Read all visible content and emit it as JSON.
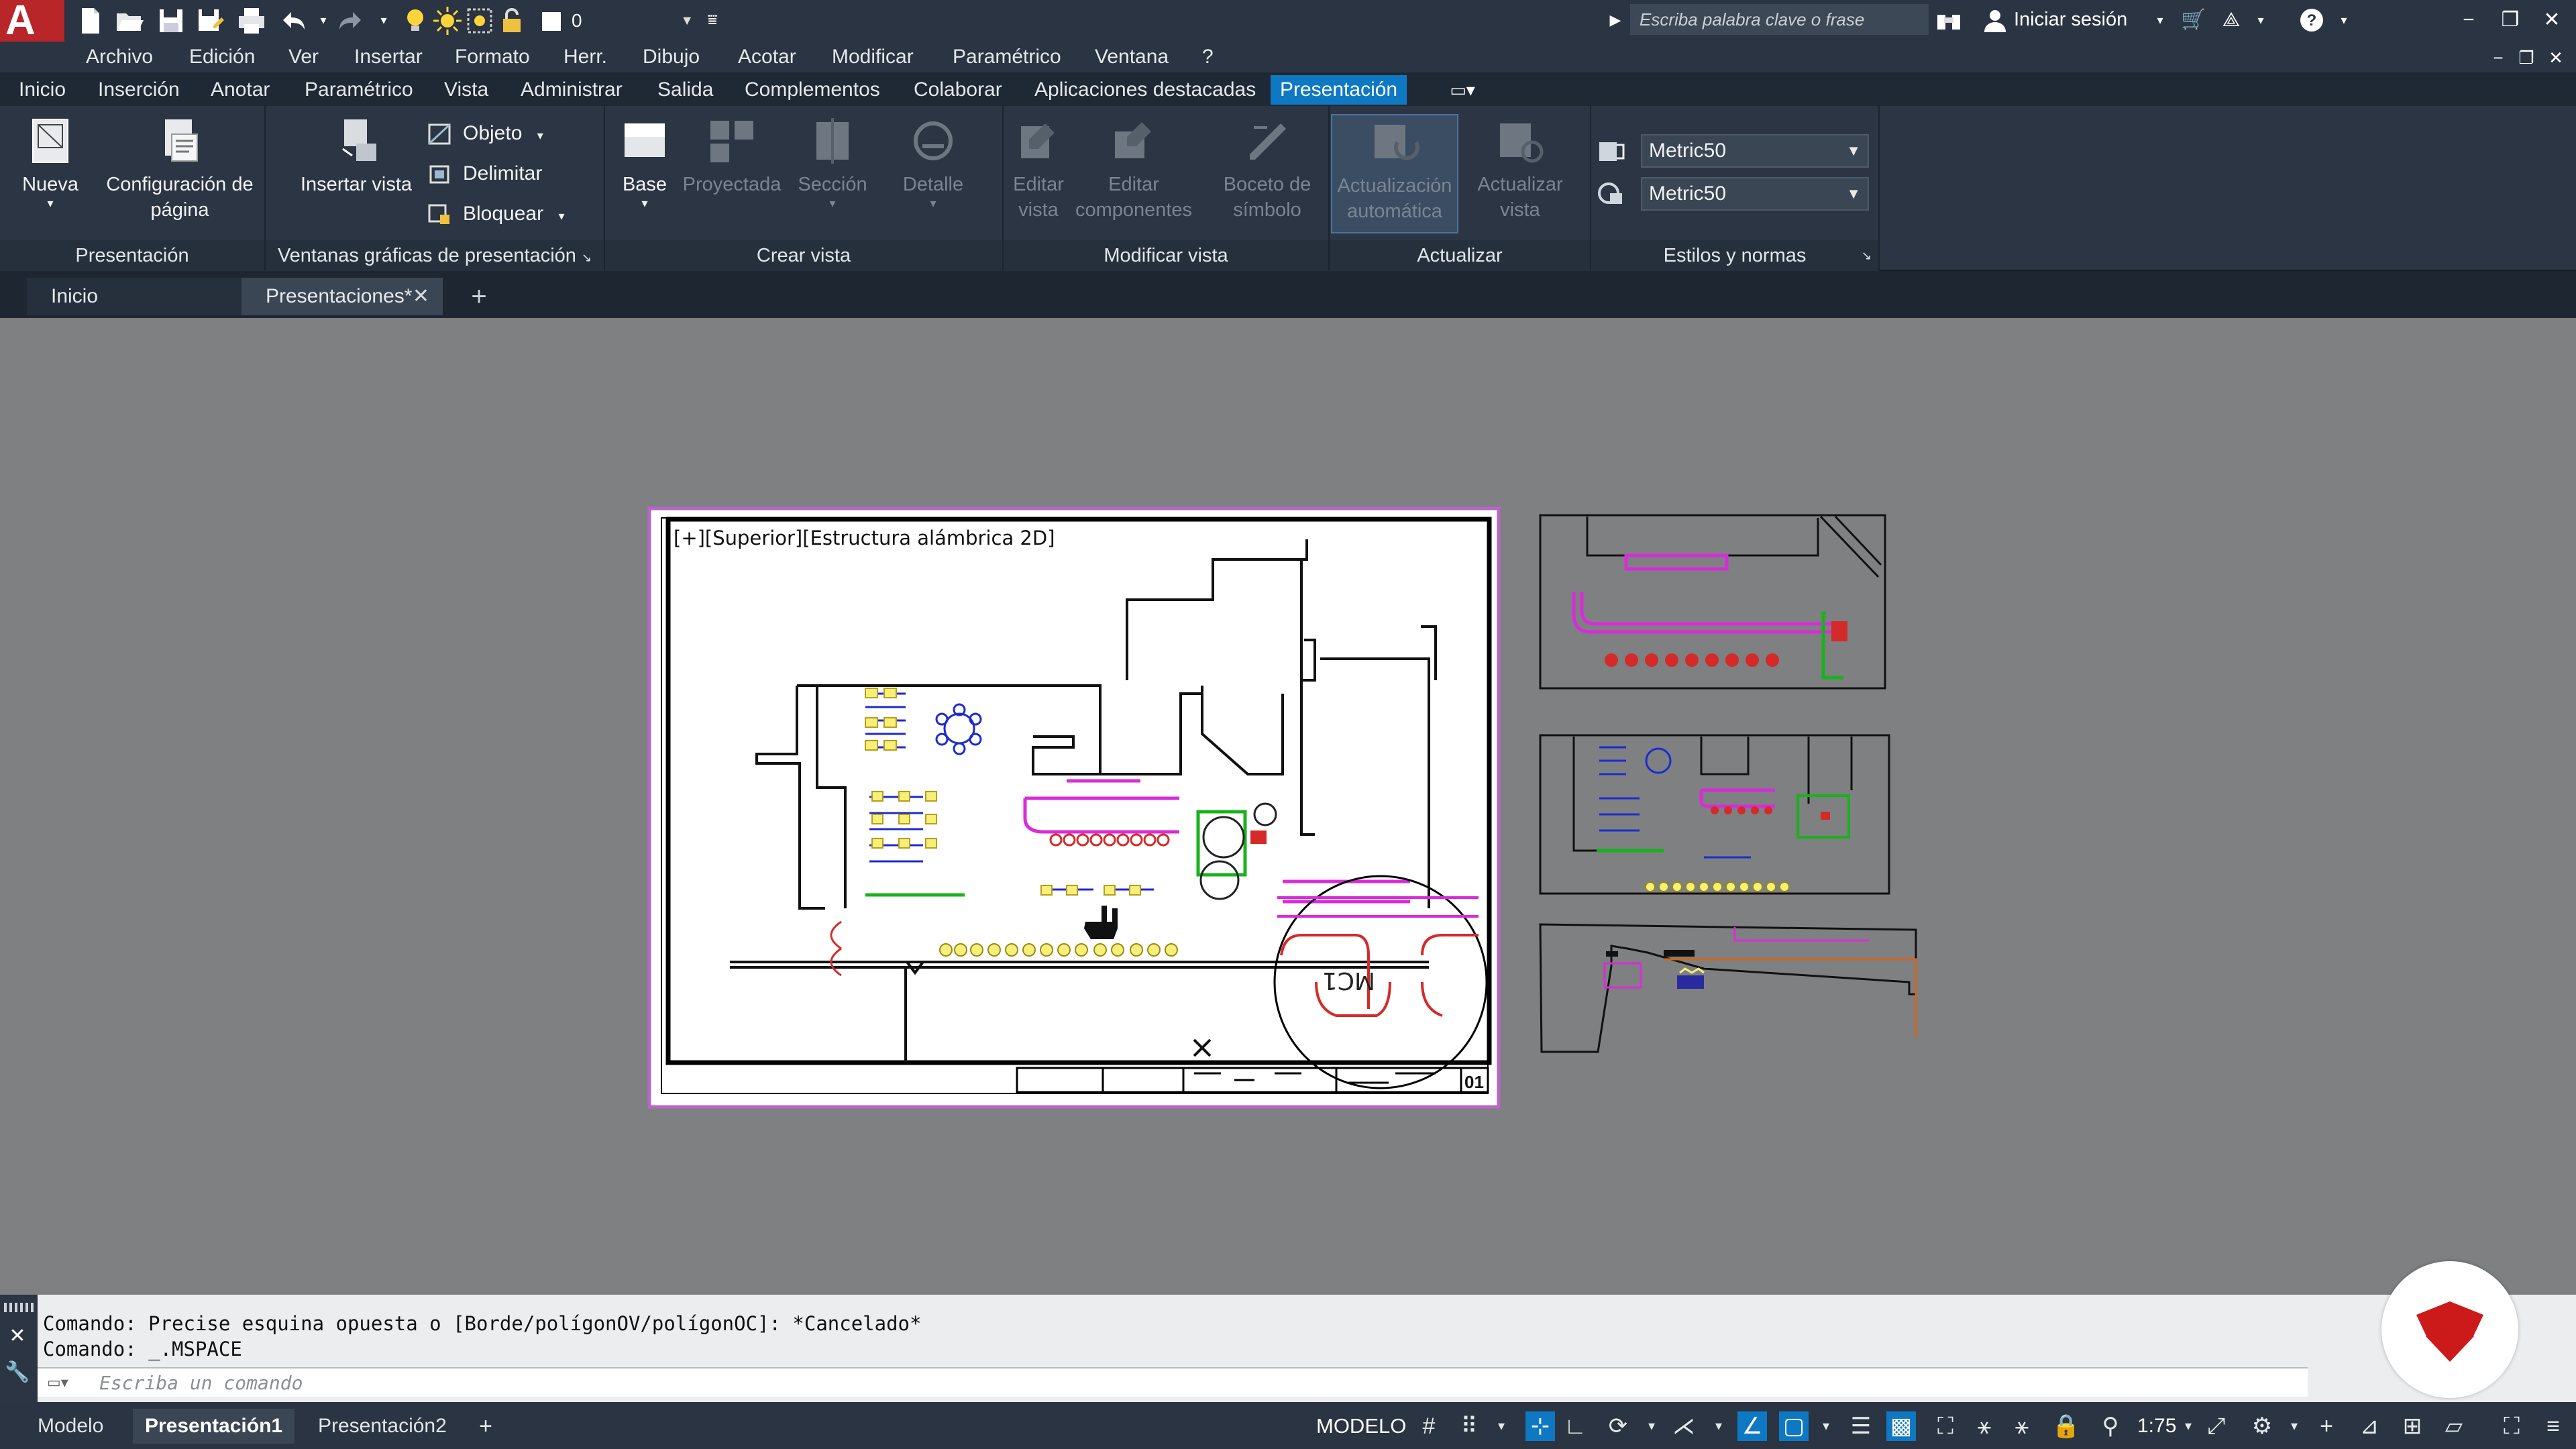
{
  "app": {
    "logo_letter": "A"
  },
  "quick_access": {
    "layer_value": "0"
  },
  "search": {
    "placeholder": "Escriba palabra clave o frase"
  },
  "user": {
    "signin_label": "Iniciar sesión"
  },
  "menu": [
    "Archivo",
    "Edición",
    "Ver",
    "Insertar",
    "Formato",
    "Herr.",
    "Dibujo",
    "Acotar",
    "Modificar",
    "Paramétrico",
    "Ventana",
    "?"
  ],
  "ribbon_tabs": [
    "Inicio",
    "Inserción",
    "Anotar",
    "Paramétrico",
    "Vista",
    "Administrar",
    "Salida",
    "Complementos",
    "Colaborar",
    "Aplicaciones destacadas",
    "Presentación"
  ],
  "active_ribbon_tab": "Presentación",
  "ribbon": {
    "presentacion": {
      "title": "Presentación",
      "nueva": "Nueva",
      "config_line1": "Configuración de",
      "config_line2": "página"
    },
    "ventanas": {
      "title": "Ventanas gráficas de presentación",
      "insertar_vista": "Insertar vista",
      "objeto": "Objeto",
      "delimitar": "Delimitar",
      "bloquear": "Bloquear"
    },
    "crear_vista": {
      "title": "Crear vista",
      "base": "Base",
      "proyectada": "Proyectada",
      "seccion": "Sección",
      "detalle": "Detalle"
    },
    "modificar_vista": {
      "title": "Modificar vista",
      "editar_vista_1": "Editar",
      "editar_vista_2": "vista",
      "editar_comp_1": "Editar",
      "editar_comp_2": "componentes",
      "boceto_1": "Boceto de",
      "boceto_2": "símbolo"
    },
    "actualizar": {
      "title": "Actualizar",
      "auto_1": "Actualización",
      "auto_2": "automática",
      "act_1": "Actualizar",
      "act_2": "vista"
    },
    "estilos": {
      "title": "Estilos y normas",
      "combo1": "Metric50",
      "combo2": "Metric50"
    }
  },
  "file_tabs": {
    "home": "Inicio",
    "active": "Presentaciones*"
  },
  "viewport": {
    "label": "[+][Superior][Estructura alámbrica 2D]",
    "sheet_number": "01"
  },
  "command": {
    "line1": "Comando: Precise esquina opuesta o [Borde/polígonOV/polígonOC]: *Cancelado*",
    "line2": "Comando: _.MSPACE",
    "placeholder": "Escriba un comando"
  },
  "status": {
    "tabs": [
      "Modelo",
      "Presentación1",
      "Presentación2"
    ],
    "active_tab": "Presentación1",
    "mode": "MODELO",
    "scale": "1:75"
  },
  "colors": {
    "accent": "#0e79c2",
    "logo_red": "#b8262a",
    "drawing_bg": "#7e8081",
    "watermark_red": "#cc1a1a"
  }
}
